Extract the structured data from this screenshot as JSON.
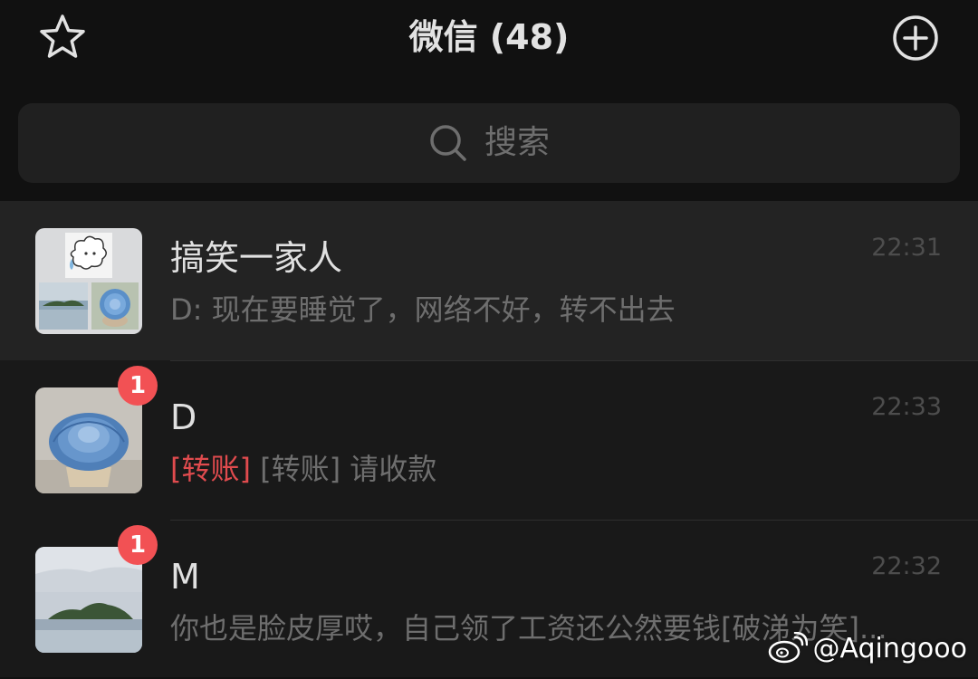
{
  "header": {
    "title": "微信 (48)",
    "left_icon": "star-icon",
    "right_icon": "plus-circle-icon"
  },
  "search": {
    "placeholder": "搜索",
    "icon": "search-icon"
  },
  "chats": [
    {
      "name": "搞笑一家人",
      "time": "22:31",
      "preview": "D: 现在要睡觉了，网络不好，转不出去",
      "pinned": true,
      "avatar": "group-collage-avatar"
    },
    {
      "name": "D",
      "time": "22:33",
      "badge": "1",
      "preview_tag": "[转账]",
      "preview": "[转账] 请收款",
      "avatar": "succulent-avatar"
    },
    {
      "name": "M",
      "time": "22:32",
      "badge": "1",
      "preview": "你也是脸皮厚哎，自己领了工资还公然要钱[破涕为笑]...",
      "avatar": "island-avatar"
    }
  ],
  "watermark": {
    "text": "@Aqingooo",
    "icon": "weibo-icon"
  },
  "colors": {
    "background": "#111111",
    "list_background": "#191919",
    "pinned_background": "#232323",
    "badge": "#f25154",
    "transfer_tag": "#e04b4e"
  }
}
